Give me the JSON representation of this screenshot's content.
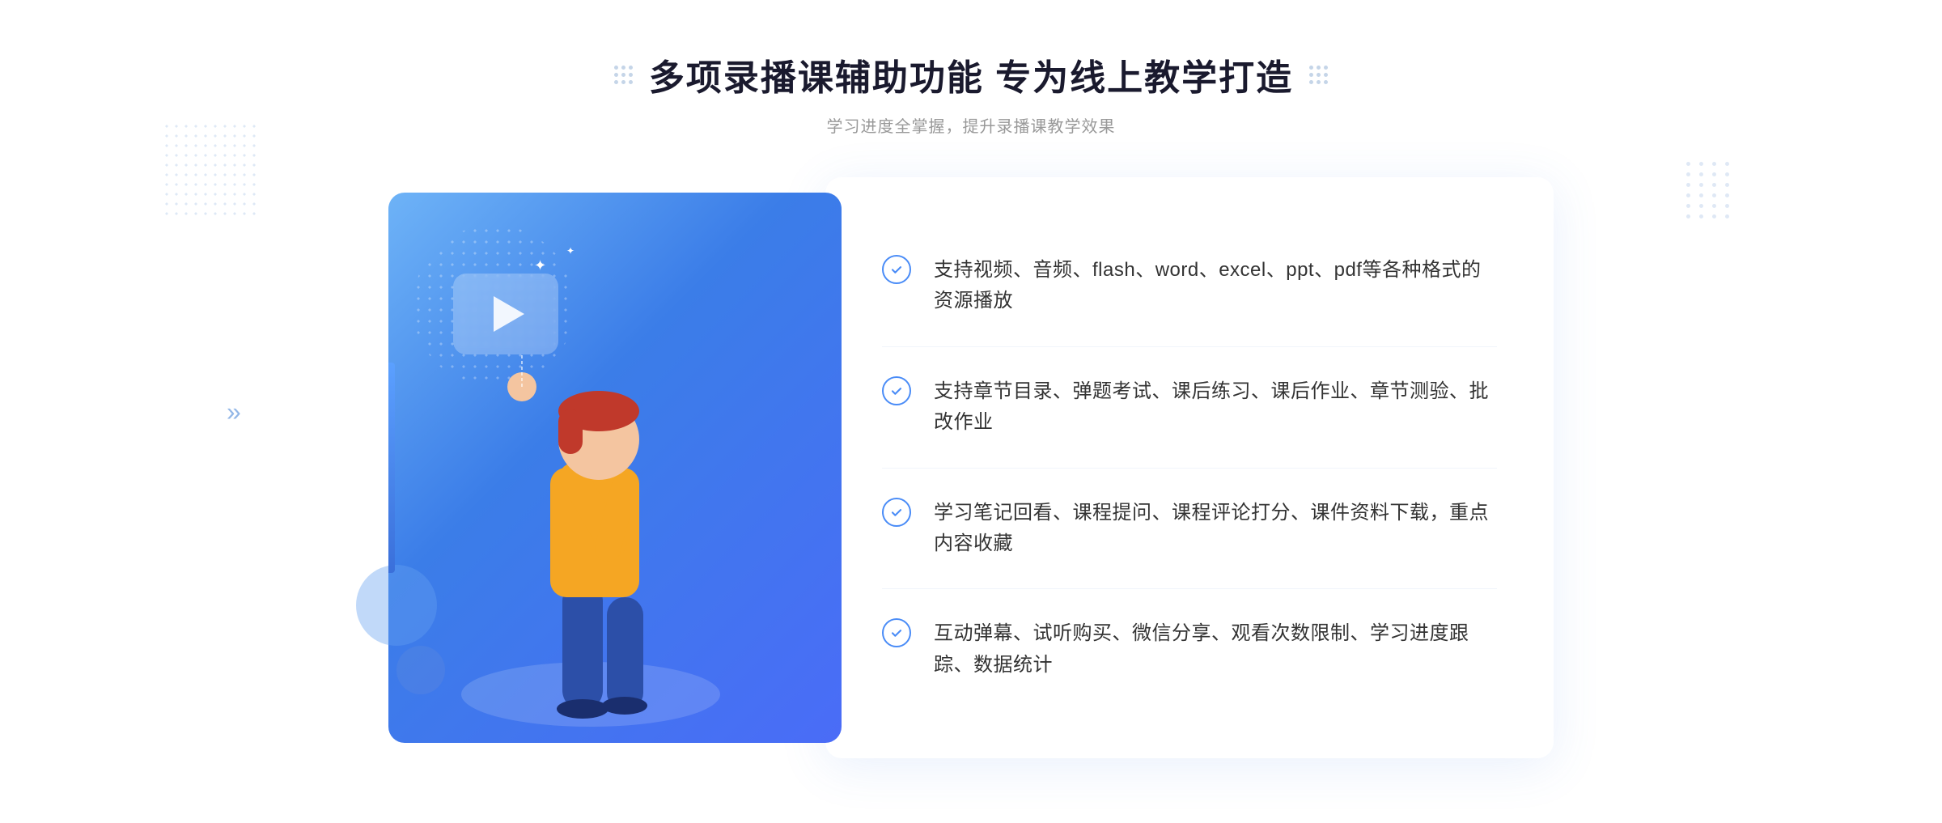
{
  "header": {
    "title": "多项录播课辅助功能 专为线上教学打造",
    "subtitle": "学习进度全掌握，提升录播课教学效果"
  },
  "decoration": {
    "left_dots_label": "decoration-dots-left",
    "right_dots_label": "decoration-dots-right"
  },
  "features": [
    {
      "id": "feature-1",
      "text": "支持视频、音频、flash、word、excel、ppt、pdf等各种格式的资源播放"
    },
    {
      "id": "feature-2",
      "text": "支持章节目录、弹题考试、课后练习、课后作业、章节测验、批改作业"
    },
    {
      "id": "feature-3",
      "text": "学习笔记回看、课程提问、课程评论打分、课件资料下载，重点内容收藏"
    },
    {
      "id": "feature-4",
      "text": "互动弹幕、试听购买、微信分享、观看次数限制、学习进度跟踪、数据统计"
    }
  ],
  "illustration": {
    "play_button_label": "play-button",
    "sparkle_1": "✦",
    "sparkle_2": "·"
  },
  "colors": {
    "primary_blue": "#4a8cf7",
    "gradient_start": "#6eb3f7",
    "gradient_end": "#4a6cf7",
    "text_dark": "#1a1a2e",
    "text_gray": "#999999",
    "text_body": "#333333",
    "border_light": "#f0f4fb"
  }
}
